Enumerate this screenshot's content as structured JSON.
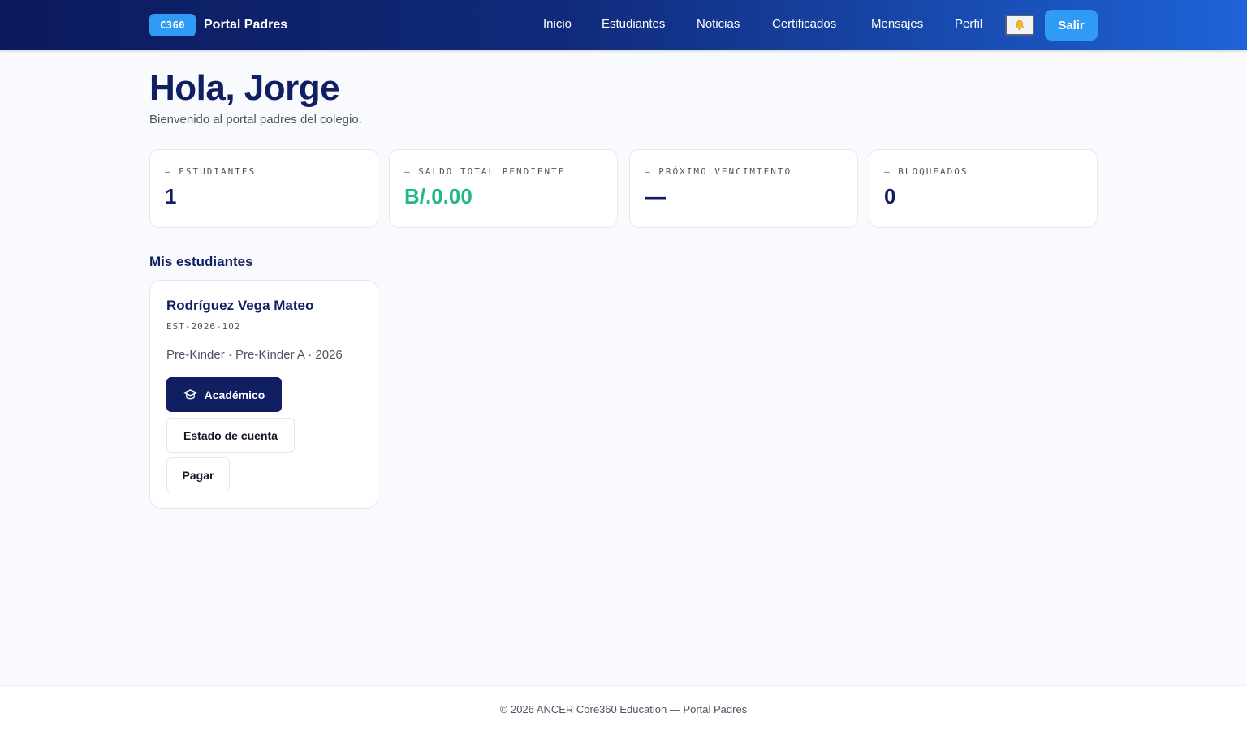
{
  "header": {
    "brand_badge": "C360",
    "brand_name": "Portal Padres",
    "nav": [
      "Inicio",
      "Estudiantes",
      "Noticias",
      "Certificados",
      "Mensajes",
      "Perfil"
    ],
    "notifications_icon": "bell-icon",
    "logout_label": "Salir",
    "colors": {
      "gradient_start": "#0c1a5c",
      "gradient_end": "#1e63d8",
      "accent": "#2f9bf5"
    }
  },
  "greeting": {
    "title": "Hola, Jorge",
    "subtitle": "Bienvenido al portal padres del colegio."
  },
  "stats": [
    {
      "label": "— ESTUDIANTES",
      "value": "1"
    },
    {
      "label": "— SALDO TOTAL PENDIENTE",
      "value": "B/.0.00",
      "color": "#1fb981"
    },
    {
      "label": "— PRÓXIMO VENCIMIENTO",
      "value": "—"
    },
    {
      "label": "— BLOQUEADOS",
      "value": "0"
    }
  ],
  "students_section": {
    "title": "Mis estudiantes",
    "students": [
      {
        "name": "Rodríguez Vega Mateo",
        "code": "EST-2026-102",
        "meta": "Pre-Kinder · Pre-Kínder A · 2026",
        "academic_label": "Académico",
        "academic_icon": "graduation-cap-icon",
        "statement_label": "Estado de cuenta",
        "pay_label": "Pagar"
      }
    ]
  },
  "footer": {
    "text": "© 2026 ANCER Core360 Education — Portal Padres"
  }
}
